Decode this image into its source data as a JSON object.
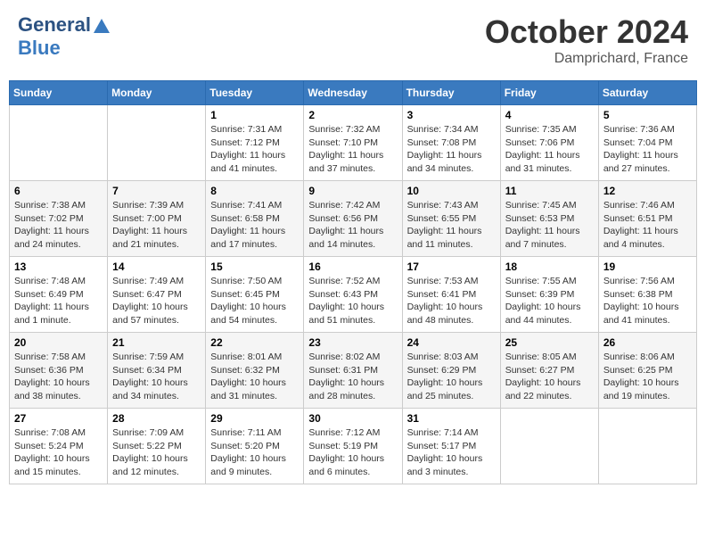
{
  "header": {
    "logo_general": "General",
    "logo_blue": "Blue",
    "title": "October 2024",
    "location": "Damprichard, France"
  },
  "days_of_week": [
    "Sunday",
    "Monday",
    "Tuesday",
    "Wednesday",
    "Thursday",
    "Friday",
    "Saturday"
  ],
  "weeks": [
    [
      {
        "day": "",
        "sunrise": "",
        "sunset": "",
        "daylight": ""
      },
      {
        "day": "",
        "sunrise": "",
        "sunset": "",
        "daylight": ""
      },
      {
        "day": "1",
        "sunrise": "Sunrise: 7:31 AM",
        "sunset": "Sunset: 7:12 PM",
        "daylight": "Daylight: 11 hours and 41 minutes."
      },
      {
        "day": "2",
        "sunrise": "Sunrise: 7:32 AM",
        "sunset": "Sunset: 7:10 PM",
        "daylight": "Daylight: 11 hours and 37 minutes."
      },
      {
        "day": "3",
        "sunrise": "Sunrise: 7:34 AM",
        "sunset": "Sunset: 7:08 PM",
        "daylight": "Daylight: 11 hours and 34 minutes."
      },
      {
        "day": "4",
        "sunrise": "Sunrise: 7:35 AM",
        "sunset": "Sunset: 7:06 PM",
        "daylight": "Daylight: 11 hours and 31 minutes."
      },
      {
        "day": "5",
        "sunrise": "Sunrise: 7:36 AM",
        "sunset": "Sunset: 7:04 PM",
        "daylight": "Daylight: 11 hours and 27 minutes."
      }
    ],
    [
      {
        "day": "6",
        "sunrise": "Sunrise: 7:38 AM",
        "sunset": "Sunset: 7:02 PM",
        "daylight": "Daylight: 11 hours and 24 minutes."
      },
      {
        "day": "7",
        "sunrise": "Sunrise: 7:39 AM",
        "sunset": "Sunset: 7:00 PM",
        "daylight": "Daylight: 11 hours and 21 minutes."
      },
      {
        "day": "8",
        "sunrise": "Sunrise: 7:41 AM",
        "sunset": "Sunset: 6:58 PM",
        "daylight": "Daylight: 11 hours and 17 minutes."
      },
      {
        "day": "9",
        "sunrise": "Sunrise: 7:42 AM",
        "sunset": "Sunset: 6:56 PM",
        "daylight": "Daylight: 11 hours and 14 minutes."
      },
      {
        "day": "10",
        "sunrise": "Sunrise: 7:43 AM",
        "sunset": "Sunset: 6:55 PM",
        "daylight": "Daylight: 11 hours and 11 minutes."
      },
      {
        "day": "11",
        "sunrise": "Sunrise: 7:45 AM",
        "sunset": "Sunset: 6:53 PM",
        "daylight": "Daylight: 11 hours and 7 minutes."
      },
      {
        "day": "12",
        "sunrise": "Sunrise: 7:46 AM",
        "sunset": "Sunset: 6:51 PM",
        "daylight": "Daylight: 11 hours and 4 minutes."
      }
    ],
    [
      {
        "day": "13",
        "sunrise": "Sunrise: 7:48 AM",
        "sunset": "Sunset: 6:49 PM",
        "daylight": "Daylight: 11 hours and 1 minute."
      },
      {
        "day": "14",
        "sunrise": "Sunrise: 7:49 AM",
        "sunset": "Sunset: 6:47 PM",
        "daylight": "Daylight: 10 hours and 57 minutes."
      },
      {
        "day": "15",
        "sunrise": "Sunrise: 7:50 AM",
        "sunset": "Sunset: 6:45 PM",
        "daylight": "Daylight: 10 hours and 54 minutes."
      },
      {
        "day": "16",
        "sunrise": "Sunrise: 7:52 AM",
        "sunset": "Sunset: 6:43 PM",
        "daylight": "Daylight: 10 hours and 51 minutes."
      },
      {
        "day": "17",
        "sunrise": "Sunrise: 7:53 AM",
        "sunset": "Sunset: 6:41 PM",
        "daylight": "Daylight: 10 hours and 48 minutes."
      },
      {
        "day": "18",
        "sunrise": "Sunrise: 7:55 AM",
        "sunset": "Sunset: 6:39 PM",
        "daylight": "Daylight: 10 hours and 44 minutes."
      },
      {
        "day": "19",
        "sunrise": "Sunrise: 7:56 AM",
        "sunset": "Sunset: 6:38 PM",
        "daylight": "Daylight: 10 hours and 41 minutes."
      }
    ],
    [
      {
        "day": "20",
        "sunrise": "Sunrise: 7:58 AM",
        "sunset": "Sunset: 6:36 PM",
        "daylight": "Daylight: 10 hours and 38 minutes."
      },
      {
        "day": "21",
        "sunrise": "Sunrise: 7:59 AM",
        "sunset": "Sunset: 6:34 PM",
        "daylight": "Daylight: 10 hours and 34 minutes."
      },
      {
        "day": "22",
        "sunrise": "Sunrise: 8:01 AM",
        "sunset": "Sunset: 6:32 PM",
        "daylight": "Daylight: 10 hours and 31 minutes."
      },
      {
        "day": "23",
        "sunrise": "Sunrise: 8:02 AM",
        "sunset": "Sunset: 6:31 PM",
        "daylight": "Daylight: 10 hours and 28 minutes."
      },
      {
        "day": "24",
        "sunrise": "Sunrise: 8:03 AM",
        "sunset": "Sunset: 6:29 PM",
        "daylight": "Daylight: 10 hours and 25 minutes."
      },
      {
        "day": "25",
        "sunrise": "Sunrise: 8:05 AM",
        "sunset": "Sunset: 6:27 PM",
        "daylight": "Daylight: 10 hours and 22 minutes."
      },
      {
        "day": "26",
        "sunrise": "Sunrise: 8:06 AM",
        "sunset": "Sunset: 6:25 PM",
        "daylight": "Daylight: 10 hours and 19 minutes."
      }
    ],
    [
      {
        "day": "27",
        "sunrise": "Sunrise: 7:08 AM",
        "sunset": "Sunset: 5:24 PM",
        "daylight": "Daylight: 10 hours and 15 minutes."
      },
      {
        "day": "28",
        "sunrise": "Sunrise: 7:09 AM",
        "sunset": "Sunset: 5:22 PM",
        "daylight": "Daylight: 10 hours and 12 minutes."
      },
      {
        "day": "29",
        "sunrise": "Sunrise: 7:11 AM",
        "sunset": "Sunset: 5:20 PM",
        "daylight": "Daylight: 10 hours and 9 minutes."
      },
      {
        "day": "30",
        "sunrise": "Sunrise: 7:12 AM",
        "sunset": "Sunset: 5:19 PM",
        "daylight": "Daylight: 10 hours and 6 minutes."
      },
      {
        "day": "31",
        "sunrise": "Sunrise: 7:14 AM",
        "sunset": "Sunset: 5:17 PM",
        "daylight": "Daylight: 10 hours and 3 minutes."
      },
      {
        "day": "",
        "sunrise": "",
        "sunset": "",
        "daylight": ""
      },
      {
        "day": "",
        "sunrise": "",
        "sunset": "",
        "daylight": ""
      }
    ]
  ]
}
